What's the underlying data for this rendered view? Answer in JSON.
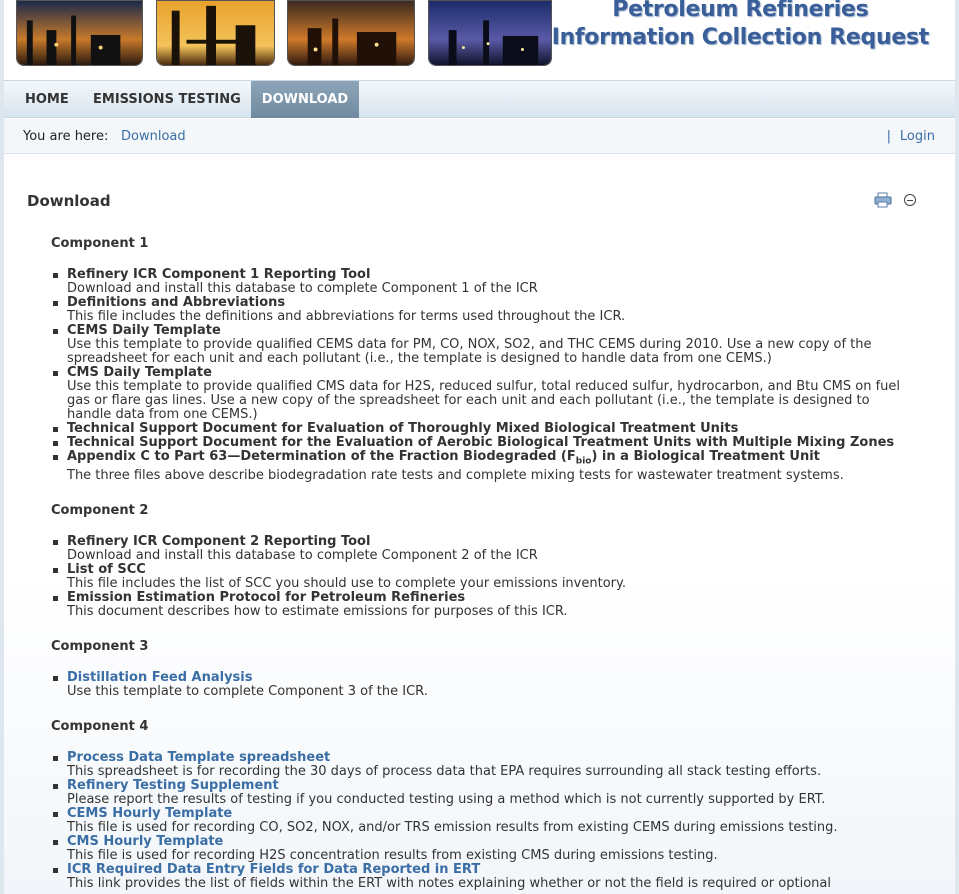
{
  "site": {
    "title_line1": "Petroleum Refineries",
    "title_line2": "Information Collection Request"
  },
  "nav": {
    "items": [
      {
        "label": "HOME"
      },
      {
        "label": "EMISSIONS TESTING"
      },
      {
        "label": "DOWNLOAD",
        "active": true
      }
    ]
  },
  "breadcrumb": {
    "label": "You are here:",
    "link": "Download",
    "separator": "|",
    "login": "Login"
  },
  "main": {
    "title": "Download",
    "icons": [
      "print-icon",
      "collapse-icon"
    ],
    "sections": [
      {
        "heading": "Component 1",
        "items": [
          {
            "title": "Refinery ICR Component 1 Reporting Tool",
            "desc": "Download and install this database to complete Component 1 of the ICR"
          },
          {
            "title": "Definitions and Abbreviations",
            "desc": "This file includes the definitions and abbreviations for terms used throughout the ICR."
          },
          {
            "title": "CEMS Daily Template",
            "desc": "Use this template to provide qualified CEMS data for PM, CO, NOX, SO2, and THC CEMS during 2010.  Use a new copy of the spreadsheet for each unit and each pollutant (i.e., the template is designed to handle data from one CEMS.)"
          },
          {
            "title": "CMS Daily Template",
            "desc": "Use this template to provide qualified CMS data for H2S, reduced sulfur, total reduced sulfur, hydrocarbon, and Btu CMS on fuel gas or flare gas lines.  Use a new copy of the spreadsheet for each unit and each pollutant (i.e., the template is designed to handle data from one CEMS.)"
          },
          {
            "title": "Technical Support Document for Evaluation of Thoroughly Mixed Biological Treatment Units",
            "desc": ""
          },
          {
            "title": "Technical Support Document for the Evaluation of Aerobic Biological Treatment Units with Multiple Mixing Zones",
            "desc": ""
          },
          {
            "title_pre": "Appendix C to Part 63—Determination of the Fraction Biodegraded (F",
            "title_sub": "bio",
            "title_post": ") in a Biological Treatment Unit",
            "desc": "The three files above describe biodegradation rate tests and complete mixing tests for wastewater treatment systems."
          }
        ]
      },
      {
        "heading": "Component 2",
        "items": [
          {
            "title": "Refinery ICR Component 2 Reporting Tool",
            "desc": "Download and install this database to complete Component 2 of the ICR"
          },
          {
            "title": "List of SCC",
            "desc": "This file includes the list of SCC you should use to complete your emissions inventory."
          },
          {
            "title": "Emission Estimation Protocol for Petroleum Refineries",
            "desc": "This document describes how to estimate emissions for purposes of this ICR."
          }
        ]
      },
      {
        "heading": "Component 3",
        "items": [
          {
            "title": "Distillation Feed Analysis",
            "desc": "Use this template to complete Component 3 of the ICR."
          }
        ]
      },
      {
        "heading": "Component 4",
        "items": [
          {
            "title": "Process Data Template spreadsheet",
            "desc": "This spreadsheet is for recording the 30 days of process data that EPA requires surrounding all stack testing efforts."
          },
          {
            "title": "Refinery Testing Supplement",
            "desc": "Please report the results of testing if you conducted testing using a method which is not currently supported by ERT."
          },
          {
            "title": "CEMS Hourly Template",
            "desc": "This file is used for recording CO, SO2, NOX, and/or TRS emission results from existing CEMS during emissions testing."
          },
          {
            "title": "CMS Hourly Template",
            "desc": "This file is used for recording H2S concentration results from existing CMS during emissions testing."
          },
          {
            "title": "ICR Required Data Entry Fields for Data Reported in ERT",
            "desc": "This link provides the list of fields within the ERT with notes explaining whether or not the field is required or optional"
          }
        ]
      }
    ]
  }
}
